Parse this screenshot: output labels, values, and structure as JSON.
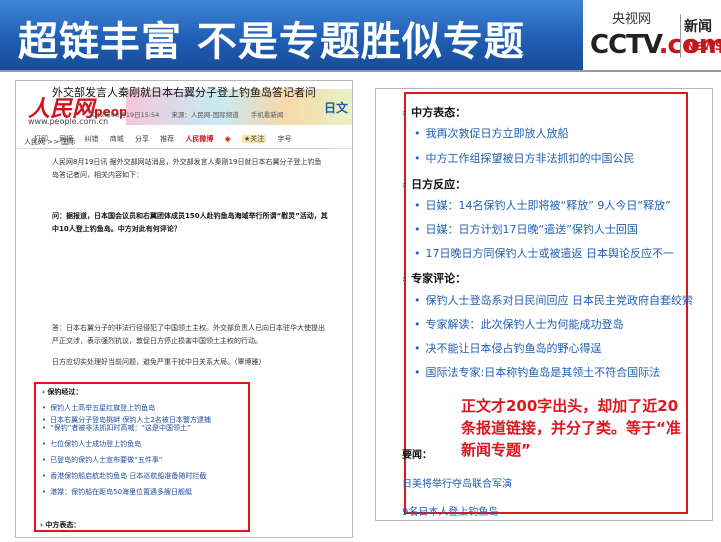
{
  "slide": {
    "title": "超链丰富 不是专题胜似专题",
    "logo": {
      "top": "央视网",
      "main_left": "CCTV",
      "main_right": ".com",
      "xinwen": "新闻",
      "news": "NEWS"
    }
  },
  "left_page": {
    "logo_text": "人民网",
    "logo_people": "people",
    "url": "www.people.com.cn",
    "banner_text": "日文",
    "breadcrumb": "人民网 >> 国际",
    "headline": "外交部发言人秦刚就日本右翼分子登上钓鱼岛答记者问",
    "meta": [
      "2012年08月19日15:54",
      "来源：人民网-国际频道",
      "手机看新闻"
    ],
    "toolbar": [
      "打印",
      "网摘",
      "纠错",
      "商城",
      "分享",
      "推荐",
      "人民微博",
      "",
      "★关注",
      "字号"
    ],
    "paragraphs": [
      "人民网8月19日讯 据外交部网站消息，外交部发言人秦刚19日就日本右翼分子登上钓鱼岛答记者问，相关内容如下：",
      "问：据报道，日本国会议员和右翼团体成员150人赴钓鱼岛海域举行所谓“慰灵”活动，其中10人登上钓鱼岛。中方对此有何评论？",
      "答：日本右翼分子的非法行径侵犯了中国领土主权。外交部负责人已向日本驻华大使提出严正交涉，表示强烈抗议，敦促日方停止损害中国领土主权的行动。",
      "日方应切实处理好当前问题，避免严重干扰中日关系大局。（覃博雅）"
    ],
    "list_title": "保钓经过：",
    "list_items": [
      "保钓人士高举五星红旗登上钓鱼岛",
      "日本右翼分子登岛挑衅 保钓人士2名被日本警方逮捕",
      "“保钓”者被非法抓扣时高喊：“这是中国领土”",
      "七位保钓人士成功登上钓鱼岛",
      "已登岛的保钓人士宣布要做“五件事”",
      "香港保钓船启航赴钓鱼岛 日本巡航船准备随时拦截",
      "港媒：保钓船在距岛50海里位置遇多艘日舰艇"
    ],
    "next_section": "中方表态："
  },
  "right_page": {
    "sections": [
      {
        "title": "中方表态：",
        "items": [
          "我再次敦促日方立即放人放船",
          "中方工作组探望被日方非法抓扣的中国公民"
        ]
      },
      {
        "title": "日方反应：",
        "items": [
          "日媒：14名保钓人士即将被“释放” 9人今日“释放”",
          "日媒：日方计划17日晚“遣送”保钓人士回国",
          "17日晚日方同保钓人士或被遣返 日本舆论反应不一"
        ]
      },
      {
        "title": "专家评论：",
        "items": [
          "保钓人士登岛系对日民间回应 日本民主党政府自套绞索",
          "专家解读：此次保钓人士为何能成功登岛",
          "决不能让日本侵占钓鱼岛的野心得逞",
          "国际法专家:日本称钓鱼岛是其领土不符合国际法"
        ]
      }
    ],
    "yaowen_label": "要闻：",
    "links": [
      "日美将举行夺岛联合军演",
      "9名日本人登上钓鱼岛"
    ]
  },
  "note": "正文才200字出头，却加了近20条报道链接，并分了类。等于“准新闻专题”",
  "colors": {
    "title_bar": "#1f5fb4",
    "highlight_box": "#e0141c",
    "link": "#1f5fb4",
    "note": "#e0141c"
  }
}
